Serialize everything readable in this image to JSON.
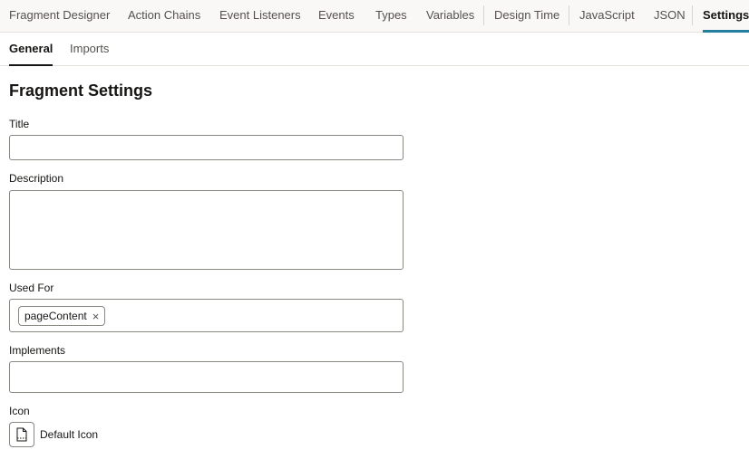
{
  "top_tabs": [
    {
      "label": "Fragment Designer"
    },
    {
      "label": "Action Chains"
    },
    {
      "label": "Event Listeners"
    },
    {
      "label": "Events"
    },
    {
      "label": "Types"
    },
    {
      "label": "Variables"
    },
    {
      "label": "Design Time"
    },
    {
      "label": "JavaScript"
    },
    {
      "label": "JSON"
    },
    {
      "label": "Settings",
      "active": true
    }
  ],
  "sub_tabs": [
    {
      "label": "General",
      "active": true
    },
    {
      "label": "Imports"
    }
  ],
  "page_title": "Fragment Settings",
  "form": {
    "title_label": "Title",
    "title_value": "",
    "description_label": "Description",
    "description_value": "",
    "used_for_label": "Used For",
    "used_for_chips": [
      "pageContent"
    ],
    "chip_remove_glyph": "×",
    "implements_label": "Implements",
    "implements_value": "",
    "icon_label": "Icon",
    "icon_name": "Default Icon",
    "icon_glyph": "document-icon"
  },
  "colors": {
    "accent": "#227e9e",
    "text": "#161513",
    "muted": "#55524d",
    "border": "#8a8782"
  }
}
